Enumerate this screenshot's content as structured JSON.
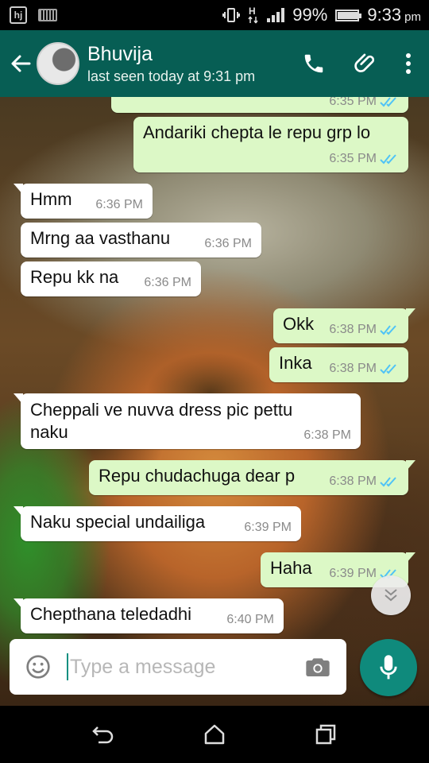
{
  "status_bar": {
    "battery_percent": "99%",
    "battery_level": 0.99,
    "time": "9:33",
    "ampm": "pm",
    "network": "H",
    "icons": [
      "hj-app-icon",
      "keyboard-icon",
      "vibrate-icon",
      "network-h-icon",
      "signal-icon",
      "battery-icon"
    ]
  },
  "header": {
    "contact_name": "Bhuvija",
    "last_seen": "last seen today at 9:31 pm",
    "color": "#075e54"
  },
  "messages": [
    {
      "side": "out",
      "text": "",
      "time": "6:35 PM",
      "read": true
    },
    {
      "side": "out",
      "text": "Andariki chepta le repu grp lo",
      "time": "6:35 PM",
      "read": true
    },
    {
      "side": "in",
      "text": "Hmm",
      "time": "6:36 PM"
    },
    {
      "side": "in",
      "text": "Mrng aa vasthanu",
      "time": "6:36 PM"
    },
    {
      "side": "in",
      "text": "Repu kk na",
      "time": "6:36 PM"
    },
    {
      "side": "out",
      "text": "Okk",
      "time": "6:38 PM",
      "read": true
    },
    {
      "side": "out",
      "text": "Inka",
      "time": "6:38 PM",
      "read": true
    },
    {
      "side": "in",
      "text": "Cheppali ve nuvva dress pic pettu naku",
      "time": "6:38 PM"
    },
    {
      "side": "out",
      "text": "Repu chudachuga dear p",
      "time": "6:38 PM",
      "read": true
    },
    {
      "side": "in",
      "text": "Naku special undailiga",
      "time": "6:39 PM"
    },
    {
      "side": "out",
      "text": "Haha",
      "time": "6:39 PM",
      "read": true
    },
    {
      "side": "in",
      "text": "Chepthana teledadhi",
      "time": "6:40 PM"
    }
  ],
  "composer": {
    "placeholder": "Type a message",
    "value": ""
  },
  "colors": {
    "outgoing_bubble": "#dcf8c6",
    "incoming_bubble": "#ffffff",
    "read_ticks": "#4fc3f7",
    "mic_button": "#0f8a7c"
  }
}
